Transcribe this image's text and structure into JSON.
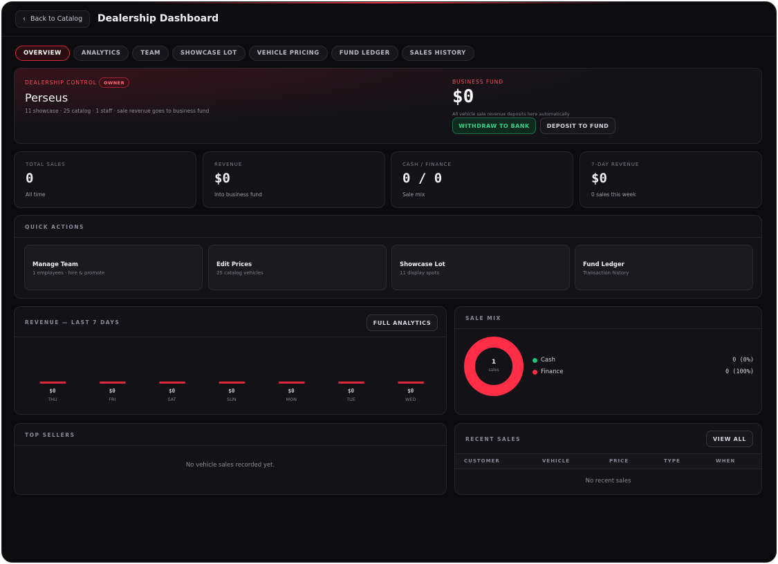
{
  "header": {
    "back_label": "Back to Catalog",
    "title": "Dealership Dashboard"
  },
  "tabs": [
    {
      "label": "OVERVIEW",
      "active": true
    },
    {
      "label": "ANALYTICS",
      "active": false
    },
    {
      "label": "TEAM",
      "active": false
    },
    {
      "label": "SHOWCASE LOT",
      "active": false
    },
    {
      "label": "VEHICLE PRICING",
      "active": false
    },
    {
      "label": "FUND LEDGER",
      "active": false
    },
    {
      "label": "SALES HISTORY",
      "active": false
    }
  ],
  "control": {
    "label": "DEALERSHIP CONTROL",
    "badge": "OWNER",
    "name": "Perseus",
    "subtitle": "11 showcase · 25 catalog · 1 staff · sale revenue goes to business fund",
    "fund_label": "BUSINESS FUND",
    "fund_amount": "$0",
    "fund_note": "All vehicle sale revenue deposits here automatically",
    "withdraw_label": "WITHDRAW TO BANK",
    "deposit_label": "DEPOSIT TO FUND"
  },
  "stats": [
    {
      "label": "TOTAL SALES",
      "value": "0",
      "sub": "All time"
    },
    {
      "label": "REVENUE",
      "value": "$0",
      "sub": "Into business fund"
    },
    {
      "label": "CASH / FINANCE",
      "value": "0 / 0",
      "sub": "Sale mix"
    },
    {
      "label": "7-DAY REVENUE",
      "value": "$0",
      "sub": "0 sales this week"
    }
  ],
  "quick_actions": {
    "title": "QUICK ACTIONS",
    "items": [
      {
        "title": "Manage Team",
        "sub": "1 employees · hire & promote"
      },
      {
        "title": "Edit Prices",
        "sub": "25 catalog vehicles"
      },
      {
        "title": "Showcase Lot",
        "sub": "11 display spots"
      },
      {
        "title": "Fund Ledger",
        "sub": "Transaction history"
      }
    ]
  },
  "revenue": {
    "title": "REVENUE — LAST 7 DAYS",
    "button_label": "FULL ANALYTICS"
  },
  "chart_data": {
    "type": "bar",
    "title": "REVENUE — LAST 7 DAYS",
    "categories": [
      "THU",
      "FRI",
      "SAT",
      "SUN",
      "MON",
      "TUE",
      "WED"
    ],
    "values": [
      0,
      0,
      0,
      0,
      0,
      0,
      0
    ],
    "value_labels": [
      "$0",
      "$0",
      "$0",
      "$0",
      "$0",
      "$0",
      "$0"
    ],
    "bar_color": "#e0283d"
  },
  "sale_mix": {
    "title": "SALE MIX",
    "center_value": "1",
    "center_label": "sales",
    "items": [
      {
        "name": "Cash",
        "value": "0 (0%)",
        "color": "#22c07a",
        "share": 0
      },
      {
        "name": "Finance",
        "value": "0 (100%)",
        "color": "#ff2d45",
        "share": 1
      }
    ]
  },
  "top_sellers": {
    "title": "TOP SELLERS",
    "empty": "No vehicle sales recorded yet."
  },
  "recent_sales": {
    "title": "RECENT SALES",
    "button_label": "VIEW ALL",
    "columns": [
      "CUSTOMER",
      "VEHICLE",
      "PRICE",
      "TYPE",
      "WHEN"
    ],
    "empty": "No recent sales"
  }
}
